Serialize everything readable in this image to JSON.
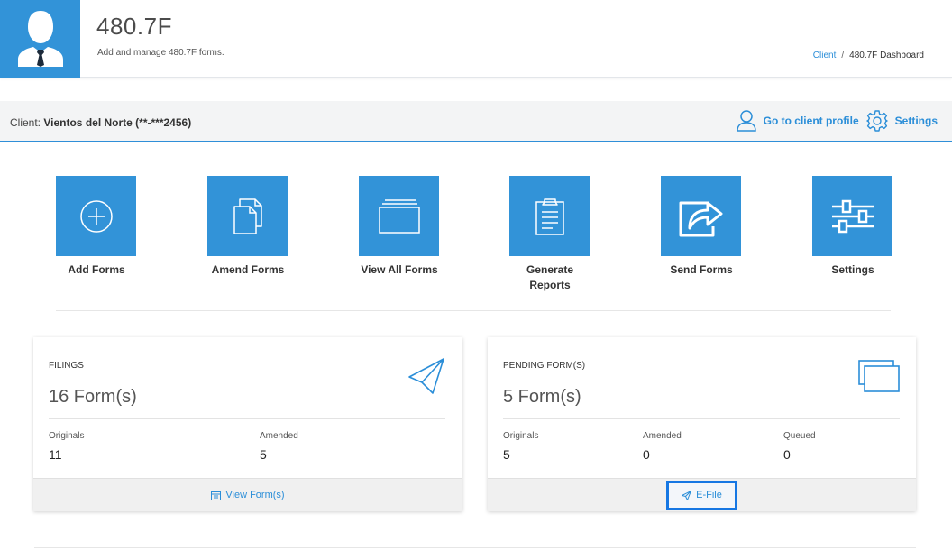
{
  "header": {
    "title": "480.7F",
    "subtitle": "Add and manage 480.7F forms.",
    "breadcrumb": {
      "link": "Client",
      "separator": "/",
      "current": "480.7F Dashboard"
    }
  },
  "client_bar": {
    "prefix": "Client:",
    "name": "Vientos del Norte (**-***2456)",
    "profile_link": "Go to client profile",
    "settings_link": "Settings"
  },
  "tiles": [
    {
      "label": "Add Forms",
      "icon": "plus-circle-icon"
    },
    {
      "label": "Amend Forms",
      "icon": "documents-icon"
    },
    {
      "label": "View All Forms",
      "icon": "folders-icon"
    },
    {
      "label": "Generate Reports",
      "icon": "clipboard-icon"
    },
    {
      "label": "Send Forms",
      "icon": "share-icon"
    },
    {
      "label": "Settings",
      "icon": "sliders-icon"
    }
  ],
  "filings_card": {
    "title": "FILINGS",
    "count": "16 Form(s)",
    "originals_label": "Originals",
    "originals_value": "11",
    "amended_label": "Amended",
    "amended_value": "5",
    "footer_link": "View Form(s)"
  },
  "pending_card": {
    "title": "PENDING FORM(S)",
    "count": "5 Form(s)",
    "originals_label": "Originals",
    "originals_value": "5",
    "amended_label": "Amended",
    "amended_value": "0",
    "queued_label": "Queued",
    "queued_value": "0",
    "footer_button": "E-File"
  },
  "colors": {
    "accent": "#3293d8",
    "link": "#2b8ed8",
    "highlight": "#1677e3"
  }
}
